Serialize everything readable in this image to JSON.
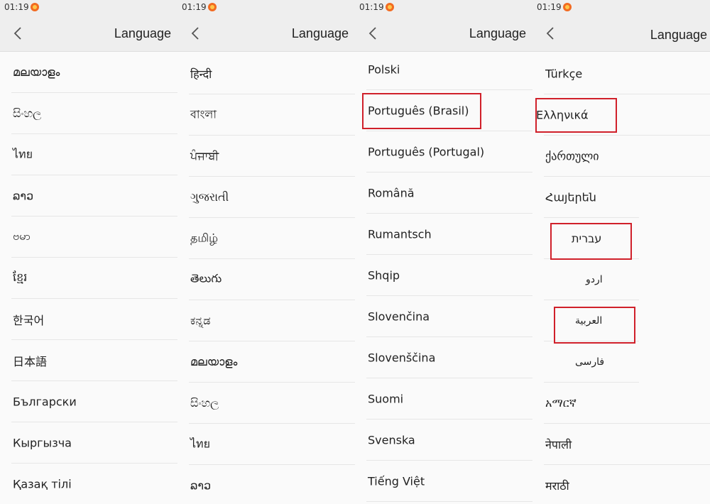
{
  "status_time": "01:19",
  "title": "Language",
  "panels": [
    {
      "items": [
        "മലയാളം",
        "සිංහල",
        "ไทย",
        "ລາວ",
        "ဗမာ",
        "ខ្មែរ",
        "한국어",
        "日本語",
        "Български",
        "Кыргызча",
        "Қазақ тілі"
      ]
    },
    {
      "items": [
        "हिन्दी",
        "বাংলা",
        "ਪੰਜਾਬੀ",
        "ગુજરાતી",
        "தமிழ்",
        "తెలుగు",
        "ಕನ್ನಡ",
        "മലയാളം",
        "සිංහල",
        "ไทย",
        "ລາວ"
      ]
    },
    {
      "items": [
        "Polski",
        "Português (Brasil)",
        "Português (Portugal)",
        "Română",
        "Rumantsch",
        "Shqip",
        "Slovenčina",
        "Slovenščina",
        "Suomi",
        "Svenska",
        "Tiếng Việt"
      ]
    },
    {
      "items": [
        "Türkçe",
        "Ελληνικά",
        "ქართული",
        "Հայերեն",
        "עברית",
        "اردو",
        "العربية",
        "فارسی",
        "አማርኛ",
        "नेपाली",
        "मराठी"
      ]
    }
  ],
  "colors": {
    "highlight": "#d0202a",
    "bar": "#eeeeee",
    "background": "#fafafa"
  }
}
